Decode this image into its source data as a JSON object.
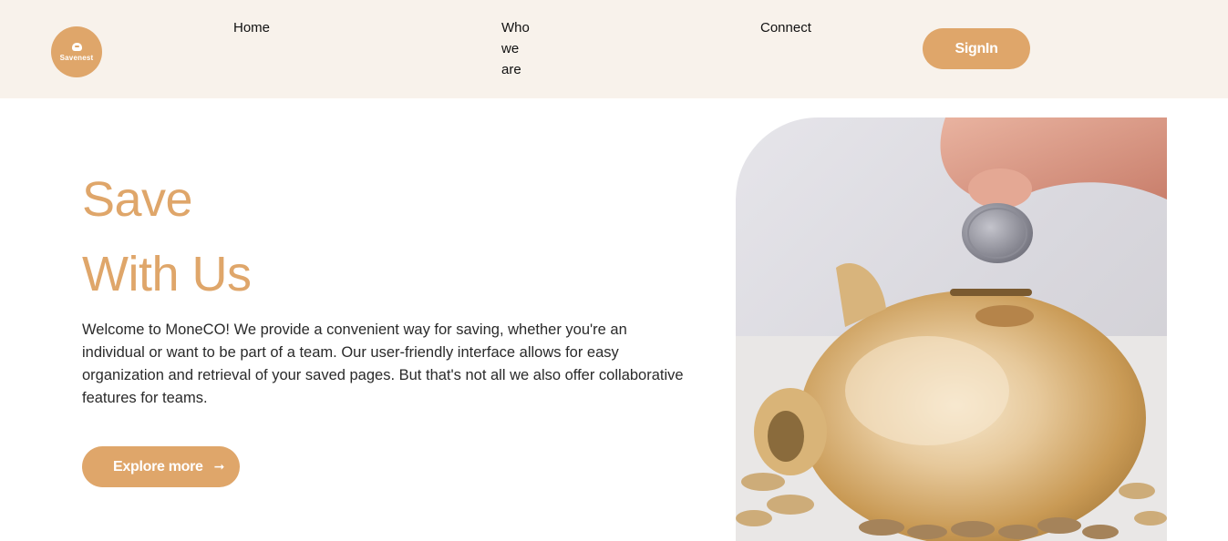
{
  "brand": {
    "logo_text": "Savenest",
    "icon": "piggy-bank-icon"
  },
  "nav": {
    "home": "Home",
    "who_we_are": "Who we are",
    "connect": "Connect",
    "signin": "SignIn"
  },
  "hero": {
    "title_line1": "Save",
    "title_line2": "With Us",
    "description": "Welcome to MoneCO! We provide a convenient way for saving, whether you're an individual or want to be part of a team. Our user-friendly interface allows for easy organization and retrieval of your saved pages. But that's not all we also offer collaborative features for teams.",
    "cta_label": "Explore more",
    "cta_icon": "arrow-right-icon",
    "image_alt": "hand dropping a coin into a gold piggy bank"
  },
  "colors": {
    "accent": "#dfa66a",
    "navbar_bg": "#f8f2eb",
    "text": "#222222",
    "background": "#ffffff"
  }
}
